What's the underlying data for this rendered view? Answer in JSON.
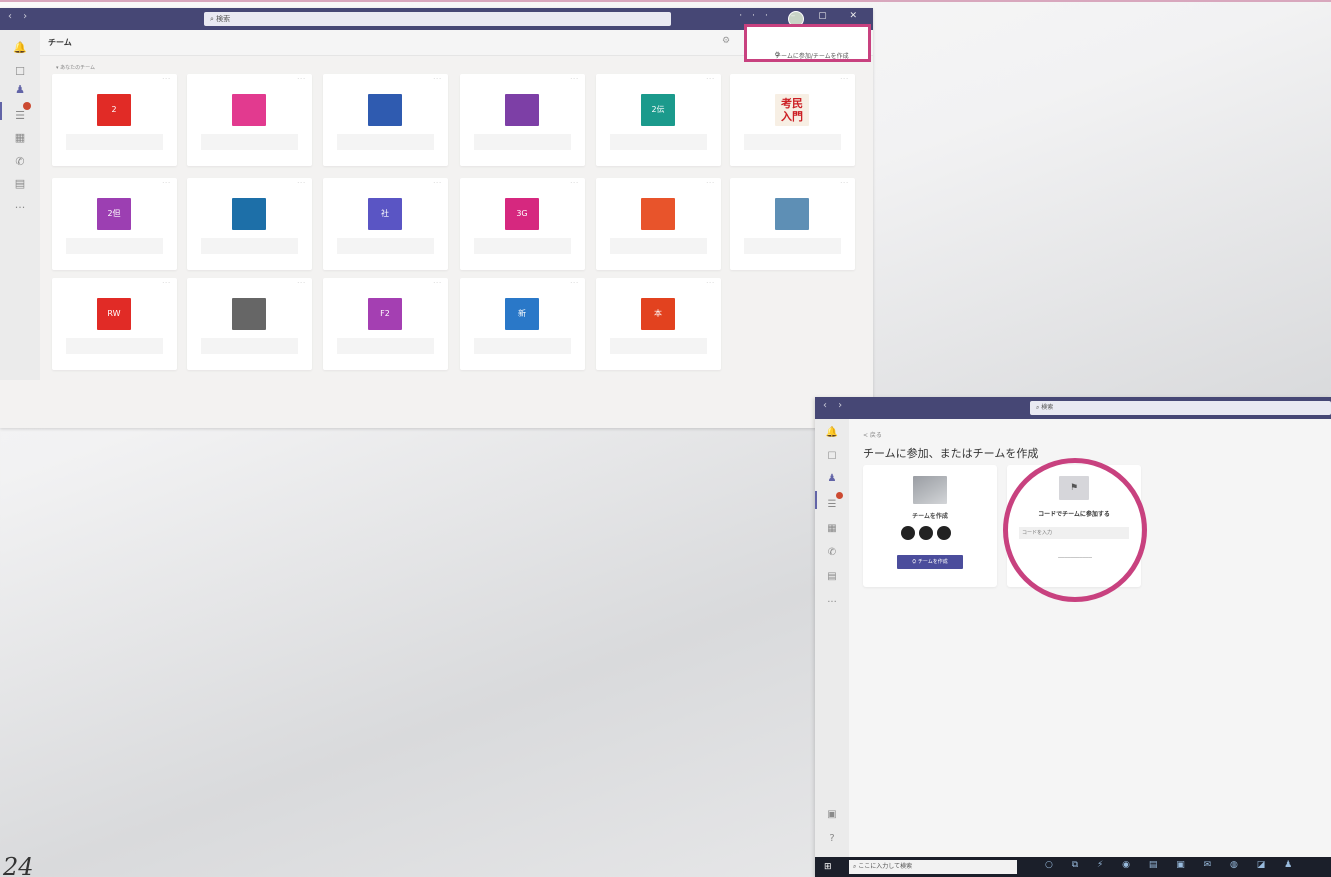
{
  "window_main": {
    "search_placeholder": "検索",
    "header_title": "チーム",
    "join_create_button": "チームに参加/チームを作成",
    "section_label": "▾ あなたのチーム",
    "teams": [
      {
        "initials": "2",
        "color": "#e12b26"
      },
      {
        "initials": "",
        "color": "#e23a8f"
      },
      {
        "initials": "",
        "color": "#2f5bb0"
      },
      {
        "initials": "",
        "color": "#7d3fa6"
      },
      {
        "initials": "2伝",
        "color": "#1b9a8c"
      },
      {
        "initials": "考民入門",
        "color": "#111111"
      },
      {
        "initials": "2但",
        "color": "#9c3fb2"
      },
      {
        "initials": "",
        "color": "#1d6fa8"
      },
      {
        "initials": "社",
        "color": "#5a55c4"
      },
      {
        "initials": "3G",
        "color": "#d6287f"
      },
      {
        "initials": "",
        "color": "#e8542b"
      },
      {
        "initials": "",
        "color": "#5e8fb5"
      },
      {
        "initials": "RW",
        "color": "#e12b26"
      },
      {
        "initials": "",
        "color": "#666666"
      },
      {
        "initials": "F2",
        "color": "#a43fb2"
      },
      {
        "initials": "新",
        "color": "#2a78c8"
      },
      {
        "initials": "本",
        "color": "#e2421f"
      }
    ]
  },
  "window_join": {
    "search_placeholder": "検索",
    "back_link": "< 戻る",
    "title": "チームに参加、またはチームを作成",
    "create_label": "チームを作成",
    "create_button": "チームを作成",
    "code_label": "コードでチームに参加する",
    "code_placeholder": "コードを入力"
  },
  "taskbar": {
    "search_text": "ここに入力して検索"
  },
  "page_number": "24"
}
